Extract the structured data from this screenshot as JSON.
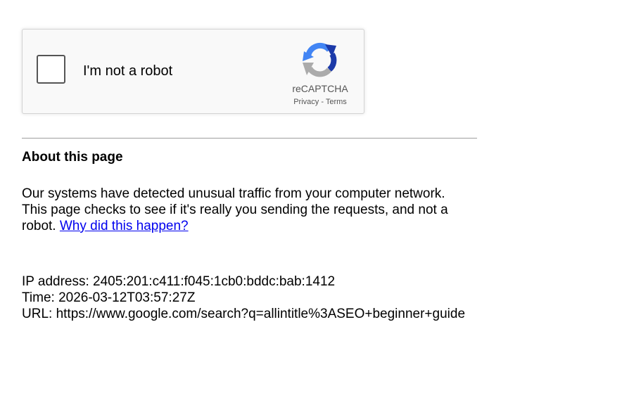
{
  "recaptcha": {
    "checkbox_label": "I'm not a robot",
    "checked": false,
    "brand": "reCAPTCHA",
    "privacy_link": "Privacy",
    "separator": " - ",
    "terms_link": "Terms",
    "logo_icon": "recaptcha-logo-icon",
    "colors": {
      "logo_blue_dark": "#1c3aa9",
      "logo_blue": "#4285f4",
      "logo_gray": "#ababab"
    }
  },
  "about": {
    "title": "About this page",
    "text": "Our systems have detected unusual traffic from your computer network. This page checks to see if it's really you sending the requests, and not a robot.",
    "link_text": "Why did this happen?",
    "link_color": "#0000ee"
  },
  "info": {
    "ip_line": "IP address: 2405:201:c411:f045:1cb0:bddc:bab:1412",
    "time_line": "Time: 2026-03-12T03:57:27Z",
    "url_line": "URL: https://www.google.com/search?q=allintitle%3ASEO+beginner+guide"
  }
}
